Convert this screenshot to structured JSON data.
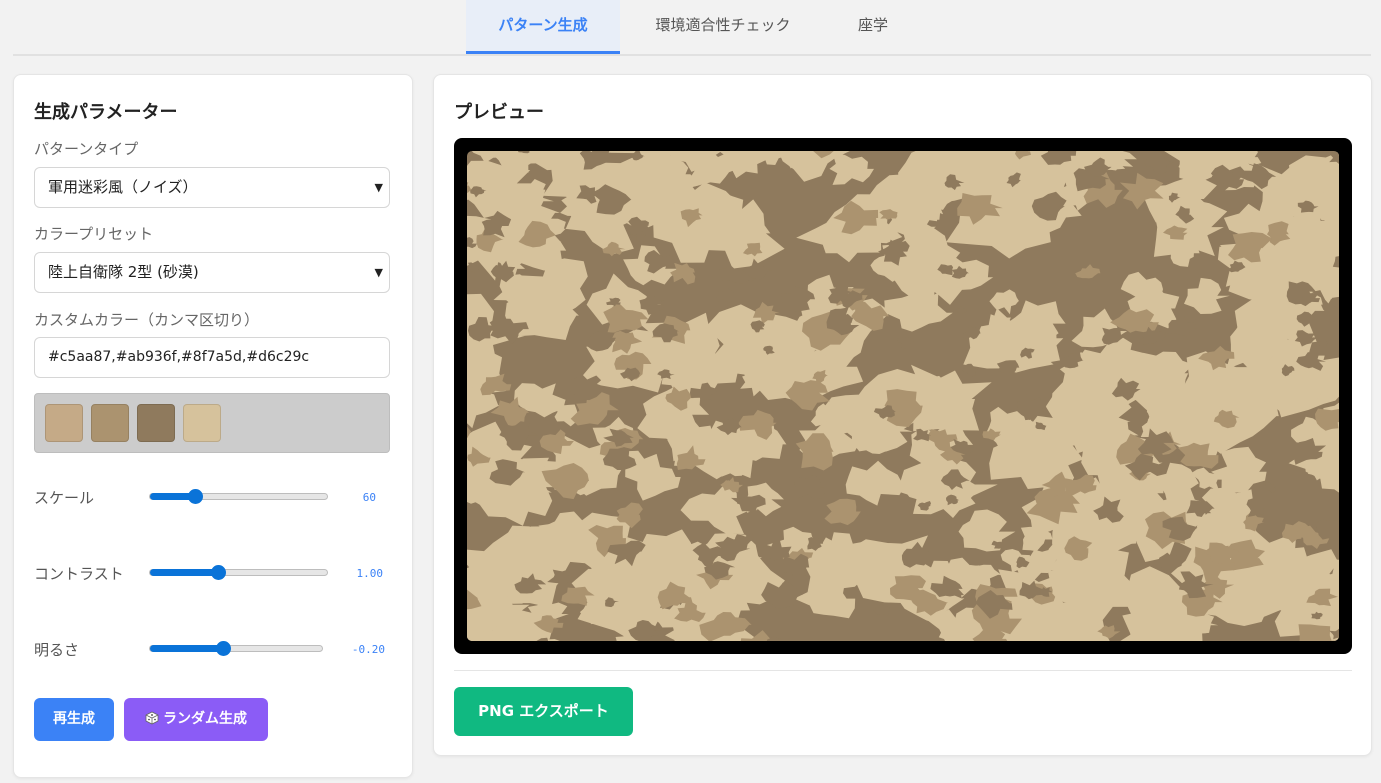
{
  "tabs": [
    {
      "label": "パターン生成",
      "active": true
    },
    {
      "label": "環境適合性チェック",
      "active": false
    },
    {
      "label": "座学",
      "active": false
    }
  ],
  "params": {
    "title": "生成パラメーター",
    "pattern_type_label": "パターンタイプ",
    "pattern_type_value": "軍用迷彩風（ノイズ）",
    "color_preset_label": "カラープリセット",
    "color_preset_value": "陸上自衛隊 2型 (砂漠)",
    "custom_color_label": "カスタムカラー（カンマ区切り）",
    "custom_color_value": "#c5aa87,#ab936f,#8f7a5d,#d6c29c",
    "swatches": [
      "#c5aa87",
      "#ab936f",
      "#8f7a5d",
      "#d6c29c"
    ],
    "sliders": [
      {
        "label": "スケール",
        "value": "60",
        "fraction": 0.25
      },
      {
        "label": "コントラスト",
        "value": "1.00",
        "fraction": 0.38
      },
      {
        "label": "明るさ",
        "value": "-0.20",
        "fraction": 0.42
      }
    ],
    "regen_button": "再生成",
    "random_button": "ランダム生成",
    "random_icon": "dice-icon"
  },
  "preview": {
    "title": "プレビュー",
    "export_button": "PNG エクスポート",
    "colors": [
      "#8f7a5d",
      "#d6c29c",
      "#ab936f",
      "#c5aa87"
    ]
  },
  "colors": {
    "accent": "#3b82f6",
    "purple": "#8b5cf6",
    "green": "#10b981"
  }
}
